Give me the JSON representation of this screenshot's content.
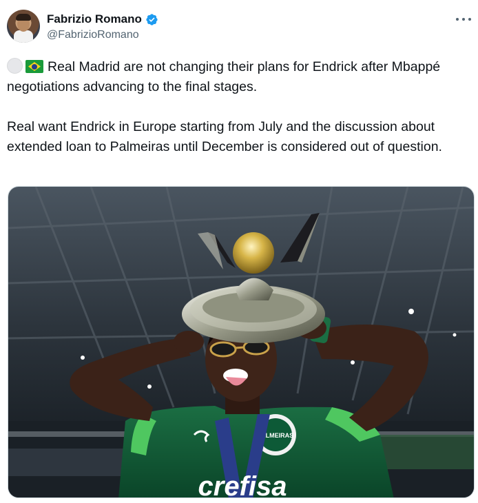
{
  "author": {
    "display_name": "Fabrizio Romano",
    "handle": "@FabrizioRomano",
    "verified": true,
    "avatar_icon": "profile-photo"
  },
  "menu_icon": "more-horizontal-icon",
  "tweet": {
    "emojis": [
      "white-circle-emoji",
      "brazil-flag-emoji"
    ],
    "paragraph1": "Real Madrid are not changing their plans for Endrick after Mbappé negotiations advancing to the final stages.",
    "paragraph2": "Real want Endrick in Europe starting from July and the discussion about extended loan to Palmeiras until December is considered out of question."
  },
  "media": {
    "type": "photo",
    "shirt_sponsor_text": "crefisa",
    "club_badge_text": "PALMEIRAS"
  },
  "colors": {
    "text_primary": "#0f1419",
    "text_secondary": "#536471",
    "verified_blue": "#1d9bf0",
    "palmeiras_green": "#0d5a37",
    "accent_green": "#5fd16a"
  }
}
